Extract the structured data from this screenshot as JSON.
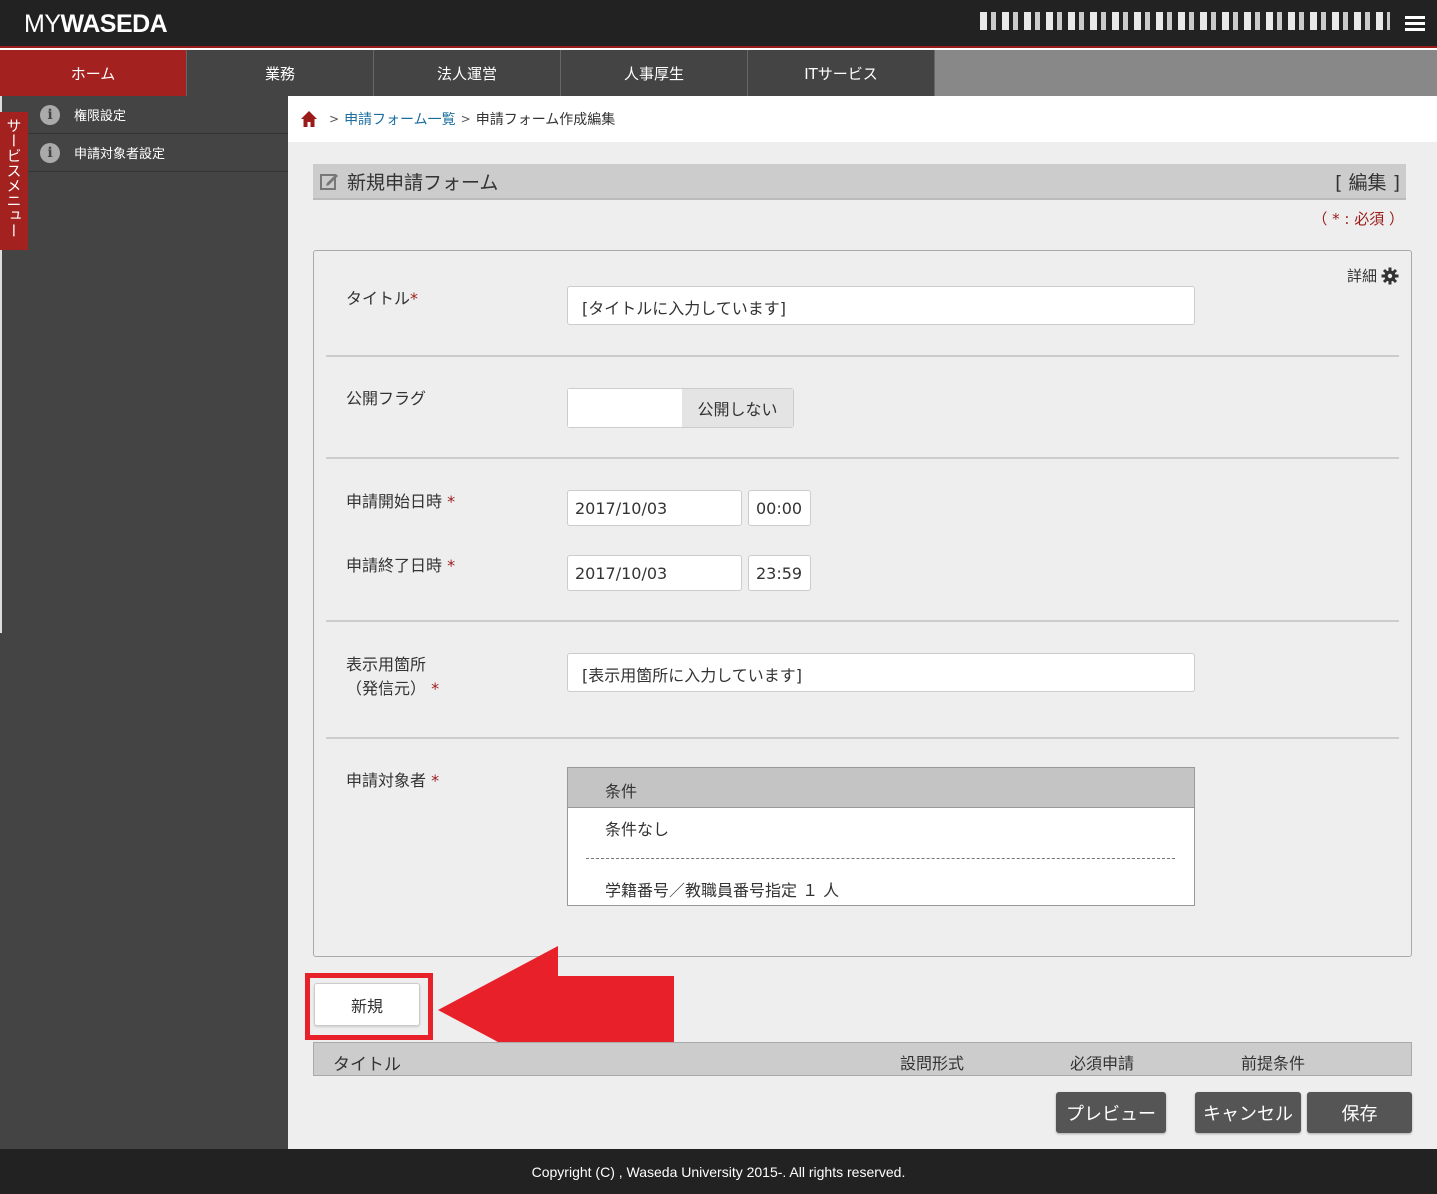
{
  "logo": {
    "my": "MY",
    "waseda": "WASEDA"
  },
  "nav": {
    "tabs": [
      {
        "label": "ホーム",
        "active": true
      },
      {
        "label": "業務"
      },
      {
        "label": "法人運営"
      },
      {
        "label": "人事厚生"
      },
      {
        "label": "ITサービス"
      }
    ]
  },
  "sidebar": {
    "service_menu": "サービスメニュー",
    "items": [
      {
        "label": "権限設定"
      },
      {
        "label": "申請対象者設定"
      }
    ]
  },
  "breadcrumb": {
    "separator": ">",
    "link": "申請フォーム一覧",
    "current": "申請フォーム作成編集"
  },
  "form": {
    "header_title": "新規申請フォーム",
    "edit_label": "[ 編集 ]",
    "required_note": "（ * : 必須 ）",
    "detail_label": "詳細",
    "required_mark": "*",
    "title_label": "タイトル",
    "title_value": "[タイトルに入力しています]",
    "public_label": "公開フラグ",
    "public_state": "公開しない",
    "start_label": "申請開始日時",
    "start_date": "2017/10/03",
    "start_time": "00:00",
    "end_label": "申請終了日時",
    "end_date": "2017/10/03",
    "end_time": "23:59",
    "display_label_1": "表示用箇所",
    "display_label_2": "（発信元）",
    "display_value": "[表示用箇所に入力しています]",
    "target_label": "申請対象者",
    "cond_header": "条件",
    "cond_rows": [
      "条件なし",
      "学籍番号／教職員番号指定 １ 人"
    ]
  },
  "new_button": "新規",
  "question_table": {
    "columns": [
      "タイトル",
      "設問形式",
      "必須申請",
      "前提条件"
    ]
  },
  "actions": {
    "preview": "プレビュー",
    "cancel": "キャンセル",
    "save": "保存"
  },
  "footer": "Copyright (C) , Waseda University 2015-. All rights reserved.",
  "colors": {
    "brand_red": "#a3211f",
    "annotation_red": "#e8202a",
    "link": "#1a6e9e"
  }
}
